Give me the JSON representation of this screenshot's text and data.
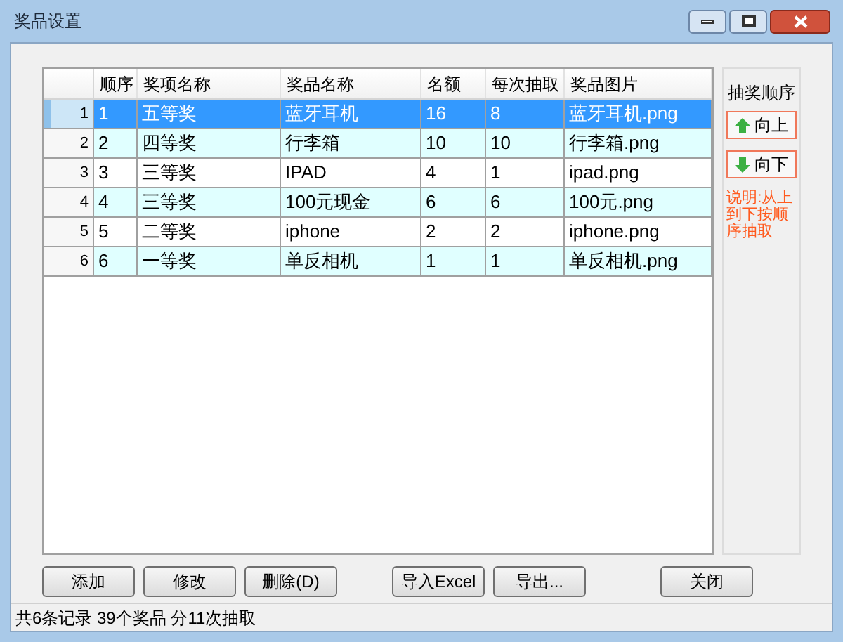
{
  "window": {
    "title": "奖品设置"
  },
  "table": {
    "columns": [
      "顺序",
      "奖项名称",
      "奖品名称",
      "名额",
      "每次抽取",
      "奖品图片"
    ],
    "rows": [
      {
        "header": "1",
        "cells": [
          "1",
          "五等奖",
          "蓝牙耳机",
          "16",
          "8",
          "蓝牙耳机.png"
        ],
        "selected": true
      },
      {
        "header": "2",
        "cells": [
          "2",
          "四等奖",
          "行李箱",
          "10",
          "10",
          "行李箱.png"
        ],
        "selected": false
      },
      {
        "header": "3",
        "cells": [
          "3",
          "三等奖",
          "IPAD",
          "4",
          "1",
          "ipad.png"
        ],
        "selected": false
      },
      {
        "header": "4",
        "cells": [
          "4",
          "三等奖",
          "100元现金",
          "6",
          "6",
          "100元.png"
        ],
        "selected": false
      },
      {
        "header": "5",
        "cells": [
          "5",
          "二等奖",
          "iphone",
          "2",
          "2",
          "iphone.png"
        ],
        "selected": false
      },
      {
        "header": "6",
        "cells": [
          "6",
          "一等奖",
          "单反相机",
          "1",
          "1",
          "单反相机.png"
        ],
        "selected": false
      }
    ]
  },
  "order_panel": {
    "title": "抽奖顺序",
    "buttons": [
      {
        "label": "向上",
        "kind": "up"
      },
      {
        "label": "向下",
        "kind": "down"
      }
    ],
    "note": "说明:从上到下按顺序抽取"
  },
  "buttons": [
    {
      "label": "添加"
    },
    {
      "label": "修改"
    },
    {
      "label": "删除(D)"
    },
    {
      "label": "导入Excel"
    },
    {
      "label": "导出..."
    },
    {
      "label": "关闭"
    }
  ],
  "status_bar": "共6条记录 39个奖品 分11次抽取"
}
